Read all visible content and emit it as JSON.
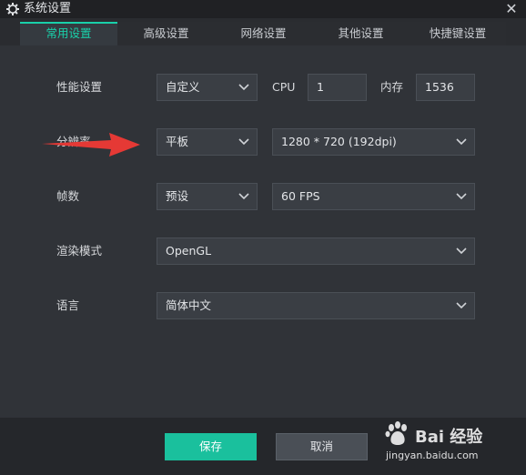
{
  "window": {
    "title": "系统设置",
    "close_glyph": "✕"
  },
  "tabs": [
    {
      "label": "常用设置",
      "active": true
    },
    {
      "label": "高级设置",
      "active": false
    },
    {
      "label": "网络设置",
      "active": false
    },
    {
      "label": "其他设置",
      "active": false
    },
    {
      "label": "快捷键设置",
      "active": false
    }
  ],
  "performance": {
    "label": "性能设置",
    "preset_value": "自定义",
    "cpu_label": "CPU",
    "cpu_value": "1",
    "memory_label": "内存",
    "memory_value": "1536"
  },
  "resolution": {
    "label": "分辨率",
    "device_value": "平板",
    "size_value": "1280 * 720 (192dpi)"
  },
  "fps": {
    "label": "帧数",
    "mode_value": "预设",
    "value": "60 FPS"
  },
  "render": {
    "label": "渲染模式",
    "value": "OpenGL"
  },
  "language": {
    "label": "语言",
    "value": "简体中文"
  },
  "footer": {
    "save_label": "保存",
    "cancel_label": "取消"
  },
  "watermark": {
    "brand": "Bai 经验",
    "url": "jingyan.baidu.com"
  },
  "icons": {
    "settings": "gear-icon",
    "dropdown": "chevron-down-icon",
    "annotation": "red-arrow-icon"
  },
  "colors": {
    "accent": "#19d0aa",
    "save": "#1ac09d",
    "arrow": "#e53935"
  }
}
